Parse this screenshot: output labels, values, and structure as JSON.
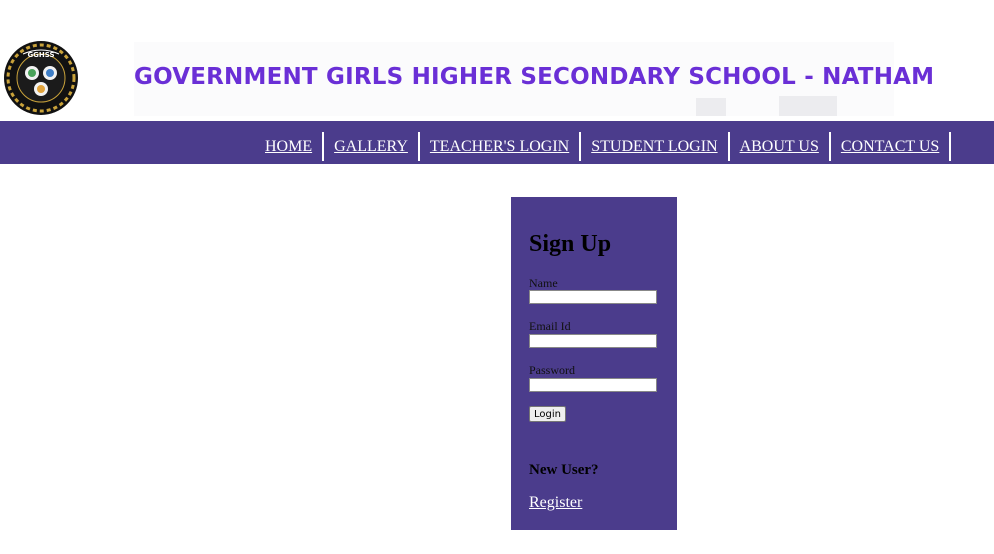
{
  "header": {
    "logo_text": "GGHSS",
    "banner_title": "GOVERNMENT GIRLS HIGHER SECONDARY SCHOOL - NATHAM"
  },
  "nav": {
    "items": [
      {
        "label": "HOME"
      },
      {
        "label": "GALLERY"
      },
      {
        "label": "TEACHER'S LOGIN"
      },
      {
        "label": "STUDENT LOGIN"
      },
      {
        "label": "ABOUT US"
      },
      {
        "label": "CONTACT US"
      }
    ]
  },
  "signup": {
    "title": "Sign Up",
    "name_label": "Name",
    "name_value": "",
    "email_label": "Email Id",
    "email_value": "",
    "password_label": "Password",
    "password_value": "",
    "login_button": "Login",
    "new_user_text": "New User?",
    "register_link": "Register"
  },
  "colors": {
    "nav_bg": "#4b3c8c",
    "panel_bg": "#4b3c8c",
    "banner_text": "#6a2fd6",
    "link_text": "#ffffff"
  }
}
